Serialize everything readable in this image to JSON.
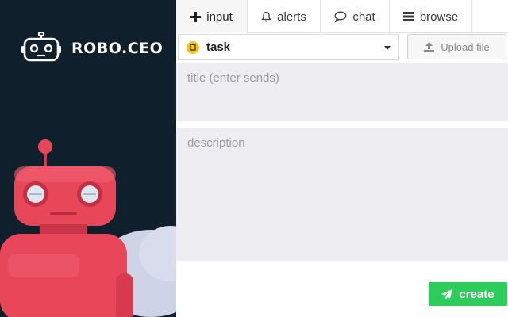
{
  "brand": {
    "name": "ROBO.CEO",
    "logo_icon": "robot-face-icon",
    "panel_color": "#0f1f2b",
    "robot_color": "#e8475a"
  },
  "tabs": [
    {
      "label": "input",
      "icon": "plus-icon",
      "active": true
    },
    {
      "label": "alerts",
      "icon": "bell-icon",
      "active": false
    },
    {
      "label": "chat",
      "icon": "chat-bubble-icon",
      "active": false
    },
    {
      "label": "browse",
      "icon": "list-icon",
      "active": false
    }
  ],
  "type_select": {
    "selected": "task",
    "badge_color": "#f0c419"
  },
  "upload": {
    "label": "Upload file",
    "icon": "upload-icon"
  },
  "title_field": {
    "placeholder": "title (enter sends)",
    "value": ""
  },
  "description_field": {
    "placeholder": "description",
    "value": ""
  },
  "create": {
    "label": "create",
    "icon": "paper-plane-icon",
    "color": "#2ecc5a"
  }
}
